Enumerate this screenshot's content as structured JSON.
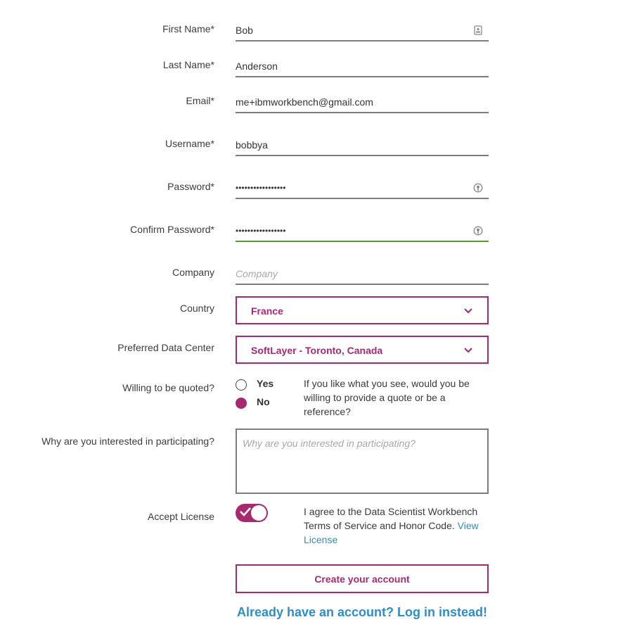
{
  "form": {
    "first_name": {
      "label": "First Name*",
      "value": "Bob"
    },
    "last_name": {
      "label": "Last Name*",
      "value": "Anderson"
    },
    "email": {
      "label": "Email*",
      "value": "me+ibmworkbench@gmail.com"
    },
    "username": {
      "label": "Username*",
      "value": "bobbya"
    },
    "password": {
      "label": "Password*",
      "value": "•••••••••••••••••"
    },
    "confirm_password": {
      "label": "Confirm Password*",
      "value": "•••••••••••••••••"
    },
    "company": {
      "label": "Company",
      "placeholder": "Company"
    },
    "country": {
      "label": "Country",
      "value": "France"
    },
    "data_center": {
      "label": "Preferred Data Center",
      "value": "SoftLayer - Toronto, Canada"
    },
    "quoted": {
      "label": "Willing to be quoted?",
      "options": [
        "Yes",
        "No"
      ],
      "selected": "No",
      "note": "If you like what you see, would you be willing to provide a quote or be a reference?"
    },
    "interest": {
      "label": "Why are you interested in participating?",
      "placeholder": "Why are you interested in participating?"
    },
    "license": {
      "label": "Accept License",
      "checked": true,
      "note_text": "I agree to the Data Scientist Workbench Terms of Service and Honor Code.",
      "link_text": "View License"
    },
    "submit_label": "Create your account",
    "login_link": "Already have an account? Log in instead!"
  },
  "colors": {
    "accent": "#a8296f",
    "link": "#2d8fc9",
    "active_underline": "#5a9a2a"
  },
  "icons": {
    "first_name": "contact-card-icon",
    "password": "password-manager-key-icon",
    "select": "chevron-down-icon"
  }
}
